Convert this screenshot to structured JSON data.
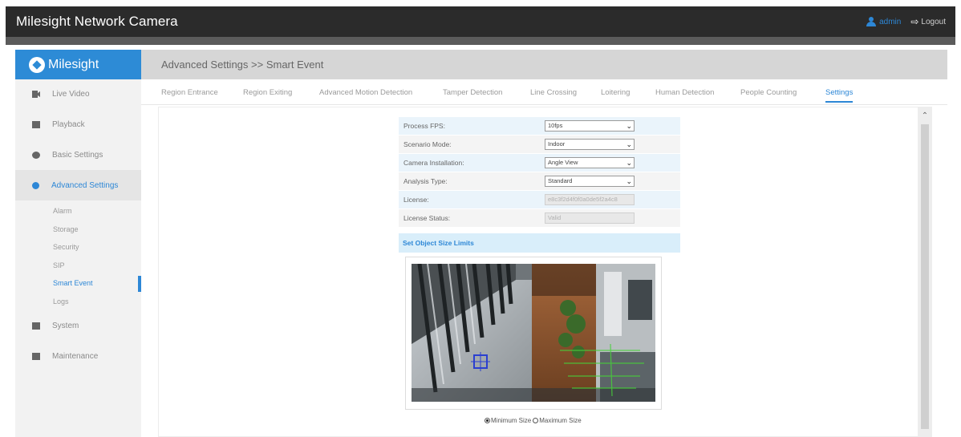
{
  "app": {
    "title": "Milesight Network Camera",
    "user": "admin",
    "logout": "Logout"
  },
  "brand": {
    "name": "Milesight",
    "accent": "#2d87d6"
  },
  "sidebar": {
    "items": [
      {
        "label": "Live Video",
        "icon": "video-camera-icon"
      },
      {
        "label": "Playback",
        "icon": "playback-icon"
      },
      {
        "label": "Basic Settings",
        "icon": "gear-icon"
      },
      {
        "label": "Advanced Settings",
        "icon": "advanced-gear-icon"
      },
      {
        "label": "System",
        "icon": "monitor-icon"
      },
      {
        "label": "Maintenance",
        "icon": "toolbox-icon"
      }
    ],
    "subitems": [
      "Alarm",
      "Storage",
      "Security",
      "SIP",
      "Smart Event",
      "Logs"
    ],
    "active_subitem": "Smart Event"
  },
  "breadcrumb": "Advanced Settings >> Smart Event",
  "tabs": [
    "Region Entrance",
    "Region Exiting",
    "Advanced Motion Detection",
    "Tamper Detection",
    "Line Crossing",
    "Loitering",
    "Human Detection",
    "People Counting",
    "Settings"
  ],
  "active_tab": "Settings",
  "form": {
    "process_fps": {
      "label": "Process FPS:",
      "value": "10fps"
    },
    "scenario_mode": {
      "label": "Scenario Mode:",
      "value": "Indoor"
    },
    "camera_installation": {
      "label": "Camera Installation:",
      "value": "Angle View"
    },
    "analysis_type": {
      "label": "Analysis Type:",
      "value": "Standard"
    },
    "license": {
      "label": "License:",
      "value": "e8c3f2d4f0f0a0de5f2a4c8"
    },
    "license_status": {
      "label": "License Status:",
      "value": "Valid"
    }
  },
  "object_size": {
    "section_title": "Set Object Size Limits",
    "min_label": "Minimum Size",
    "max_label": "Maximum Size",
    "selected": "min"
  }
}
